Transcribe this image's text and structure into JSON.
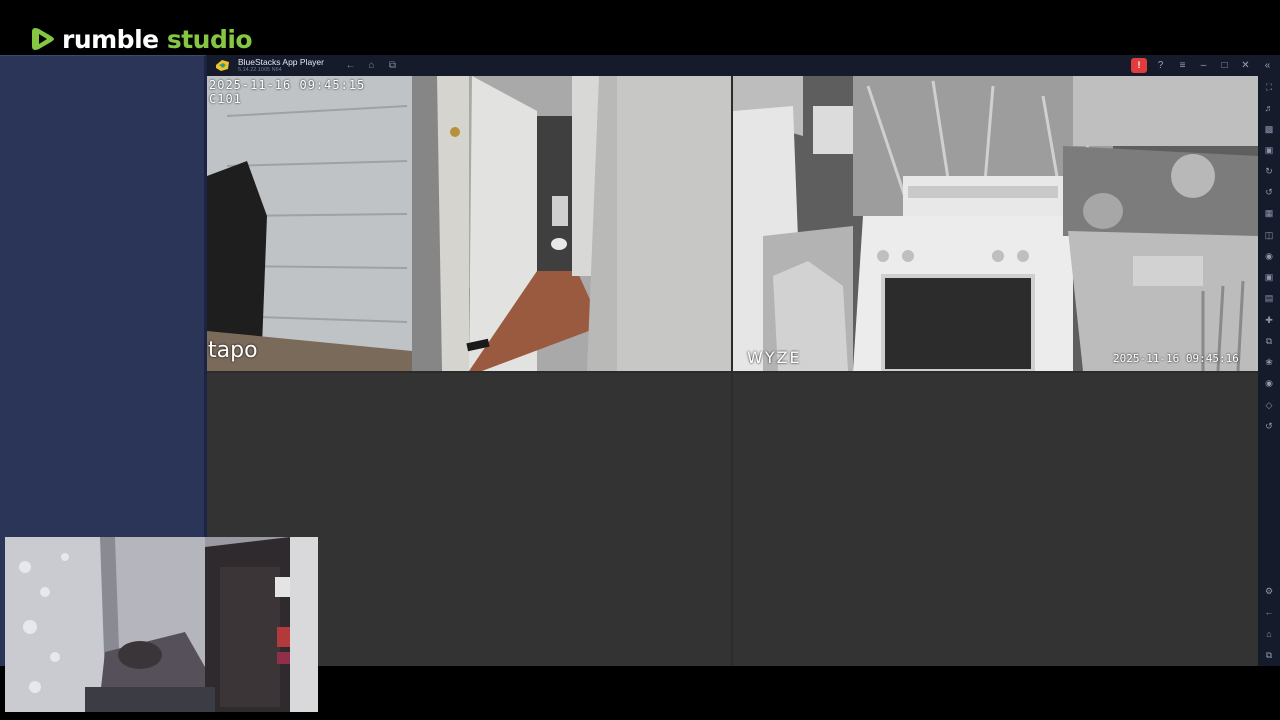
{
  "brand": {
    "word1": "rumble",
    "word2": "studio",
    "accent": "#85c742"
  },
  "bluestacks": {
    "title": "BlueStacks App Player",
    "version": "5.14.22.1005 N64",
    "nav": [
      "back-icon",
      "home-icon",
      "multi-instance-icon"
    ],
    "controls": [
      "alert-icon",
      "help-icon",
      "menu-icon",
      "minimize-icon",
      "maximize-icon",
      "close-icon",
      "collapse-sidebar-icon"
    ],
    "alert_label": "!",
    "sidebar_icons": [
      "fullscreen-icon",
      "volume-icon",
      "media-manager-icon",
      "screenshot-icon",
      "rotate-icon",
      "sync-icon",
      "macro-icon",
      "gamepad-icon",
      "screen-record-icon",
      "camera-icon",
      "folder-icon",
      "shake-icon",
      "multi-window-icon",
      "eco-mode-icon",
      "location-icon",
      "layers-icon",
      "replay-icon",
      "settings-icon",
      "back-icon",
      "home-icon",
      "recent-apps-icon"
    ]
  },
  "cameras": [
    {
      "name": "hallway-camera",
      "timestamp": "2025-11-16 09:45:15",
      "label": "C101",
      "watermark": "tapo"
    },
    {
      "name": "kitchen-camera",
      "timestamp": "2025-11-16 09:45:16",
      "watermark": "WYZE"
    }
  ]
}
